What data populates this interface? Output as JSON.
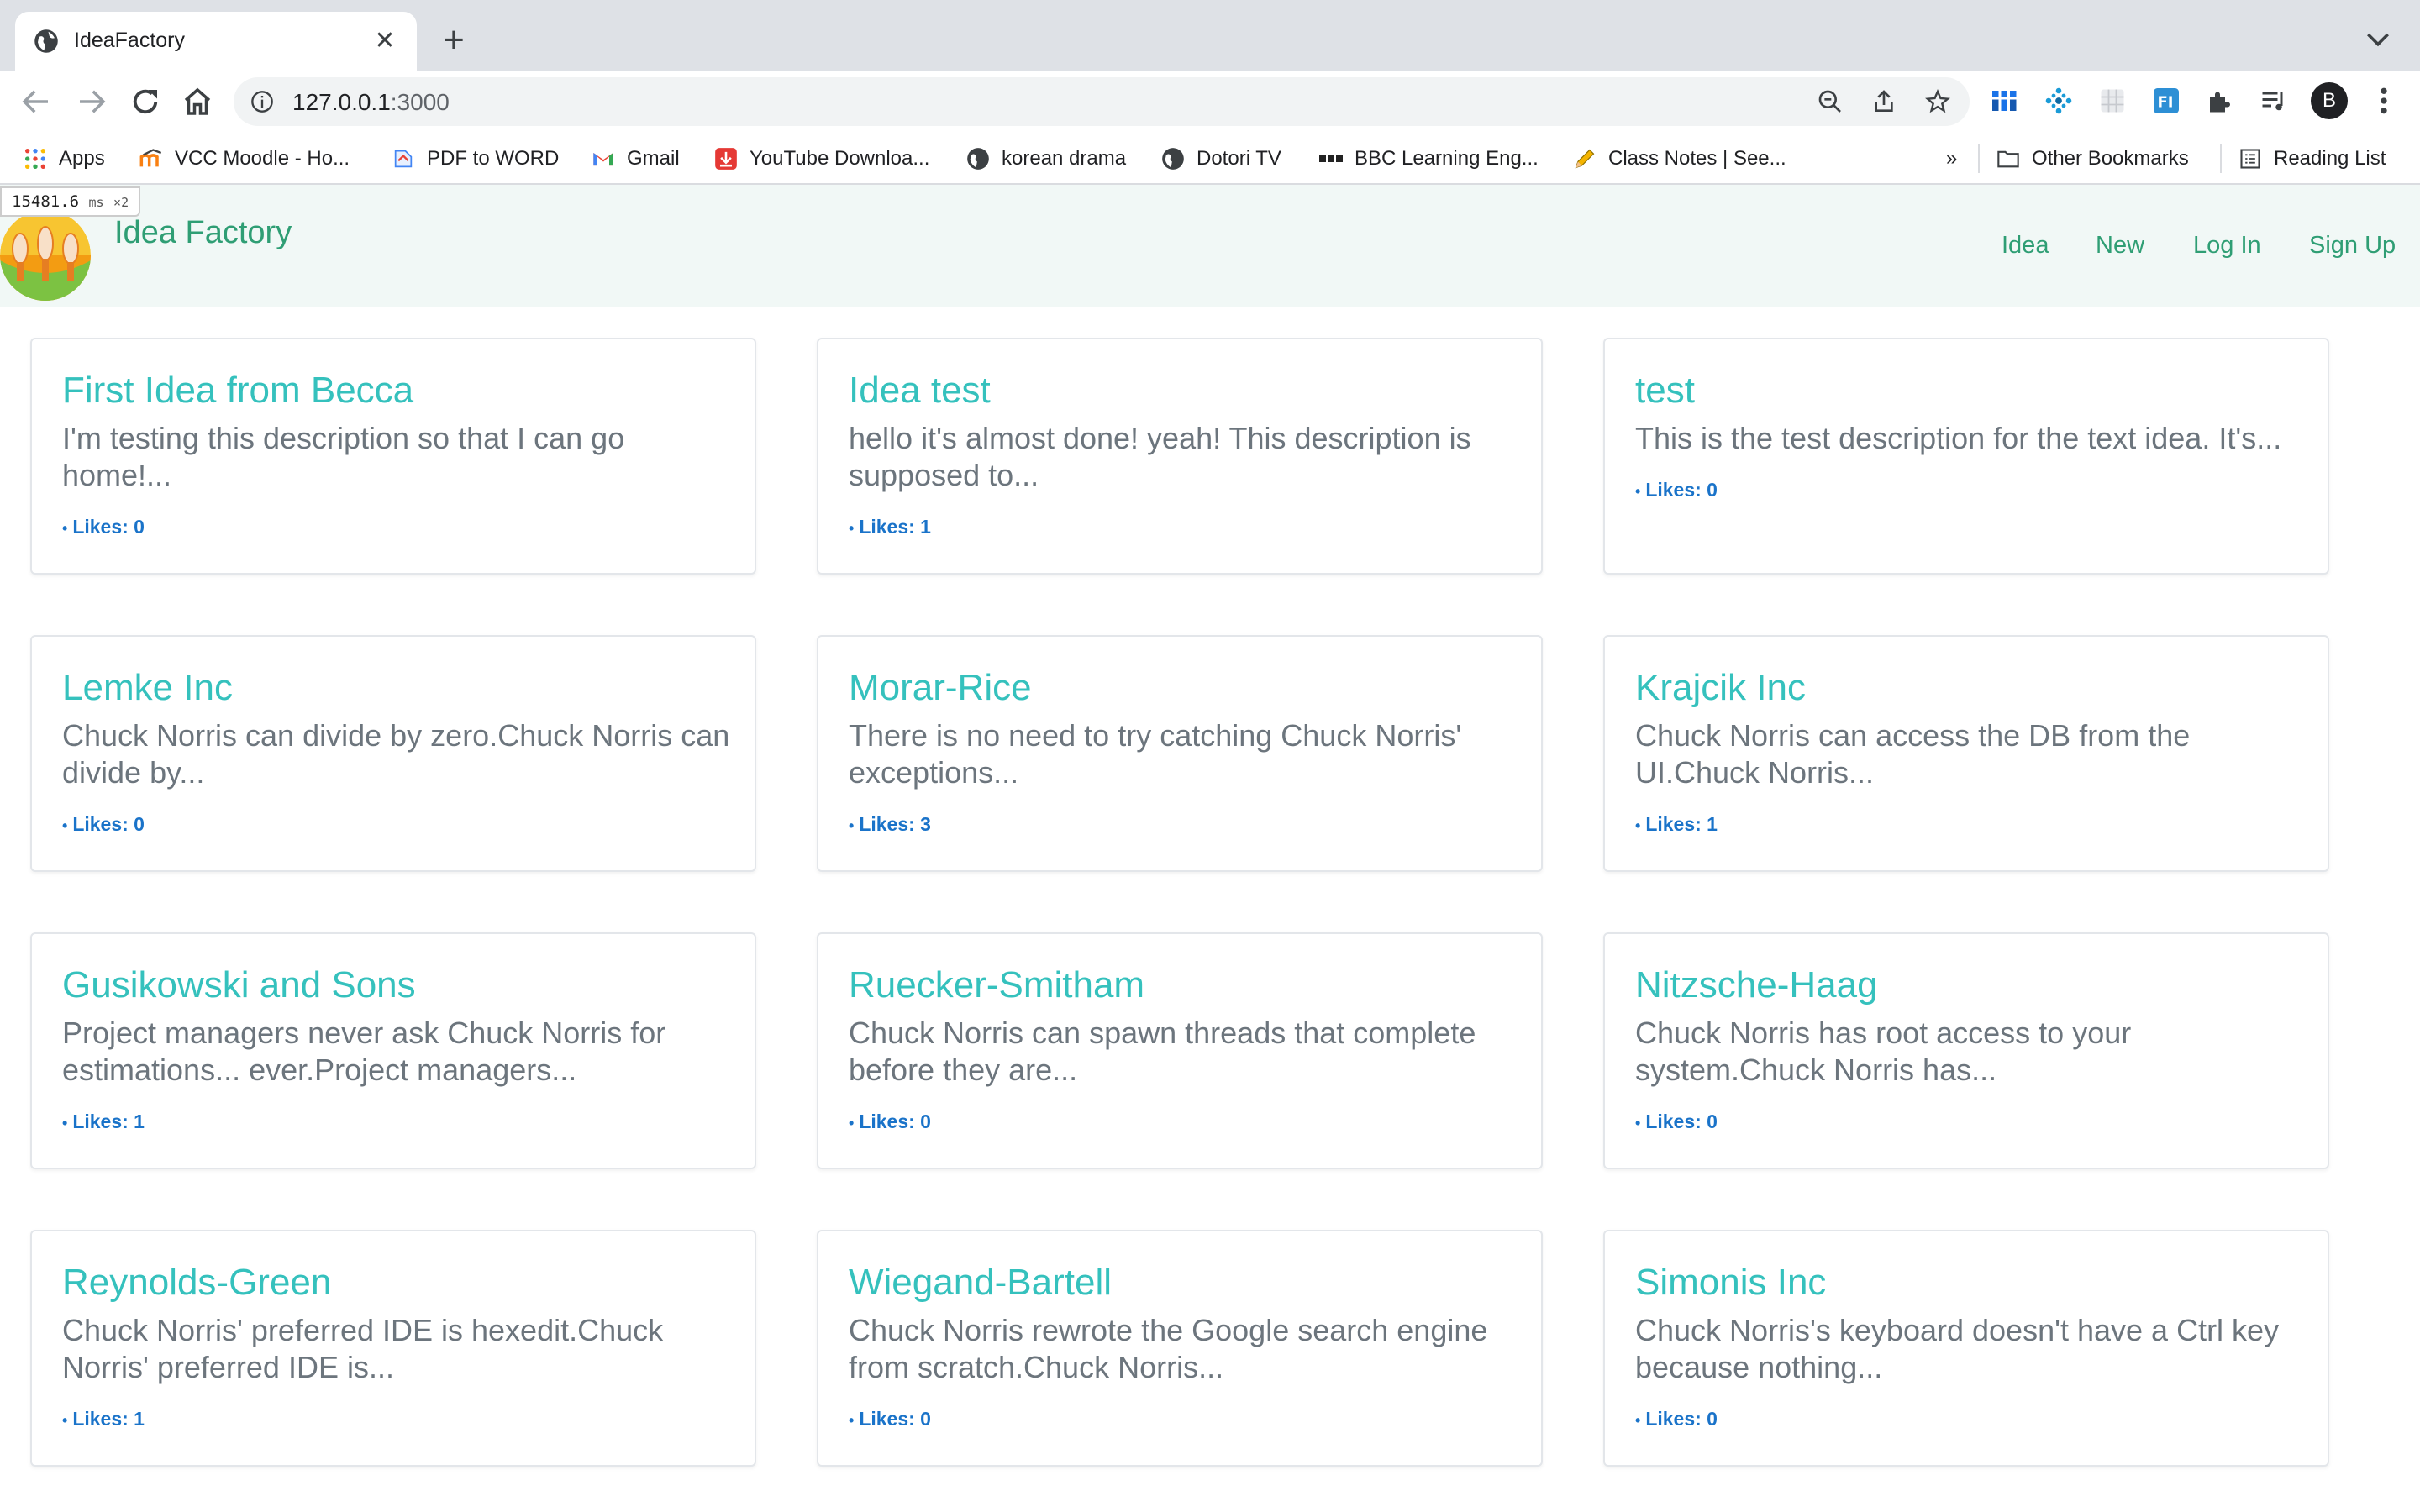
{
  "browser": {
    "tab_title": "IdeaFactory",
    "url_host": "127.0.0.1",
    "url_port": ":3000",
    "profile_initial": "B",
    "bookmarks": [
      {
        "label": "Apps",
        "icon": "apps-grid-icon"
      },
      {
        "label": "VCC Moodle - Ho...",
        "icon": "moodle-icon"
      },
      {
        "label": "PDF to WORD",
        "icon": "pdf-converter-icon"
      },
      {
        "label": "Gmail",
        "icon": "gmail-icon"
      },
      {
        "label": "YouTube Downloa...",
        "icon": "download-icon"
      },
      {
        "label": "korean drama",
        "icon": "globe-icon"
      },
      {
        "label": "Dotori TV",
        "icon": "globe-icon"
      },
      {
        "label": "BBC Learning Eng...",
        "icon": "bbc-icon"
      },
      {
        "label": "Class Notes | See...",
        "icon": "pencil-icon"
      }
    ],
    "overflow_label": "»",
    "other_bookmarks": "Other Bookmarks",
    "reading_list": "Reading List"
  },
  "perf": {
    "ms": "15481.6",
    "unit": "ms",
    "multiplier": "×2"
  },
  "navbar": {
    "brand": "Idea Factory",
    "links": [
      "Idea",
      "New",
      "Log In",
      "Sign Up"
    ]
  },
  "ideas": [
    {
      "title": "First Idea from Becca",
      "description": "I'm testing this description so that I can go home!...",
      "likes": "Likes: 0"
    },
    {
      "title": "Idea test",
      "description": "hello it's almost done! yeah! This description is supposed to...",
      "likes": "Likes: 1"
    },
    {
      "title": "test",
      "description": "This is the test description for the text idea. It's...",
      "likes": "Likes: 0"
    },
    {
      "title": "Lemke Inc",
      "description": "Chuck Norris can divide by zero.Chuck Norris can divide by...",
      "likes": "Likes: 0"
    },
    {
      "title": "Morar-Rice",
      "description": "There is no need to try catching Chuck Norris' exceptions...",
      "likes": "Likes: 3"
    },
    {
      "title": "Krajcik Inc",
      "description": "Chuck Norris can access the DB from the UI.Chuck Norris...",
      "likes": "Likes: 1"
    },
    {
      "title": "Gusikowski and Sons",
      "description": "Project managers never ask Chuck Norris for estimations... ever.Project managers...",
      "likes": "Likes: 1"
    },
    {
      "title": "Ruecker-Smitham",
      "description": "Chuck Norris can spawn threads that complete before they are...",
      "likes": "Likes: 0"
    },
    {
      "title": "Nitzsche-Haag",
      "description": "Chuck Norris has root access to your system.Chuck Norris has...",
      "likes": "Likes: 0"
    },
    {
      "title": "Reynolds-Green",
      "description": "Chuck Norris' preferred IDE is hexedit.Chuck Norris' preferred IDE is...",
      "likes": "Likes: 1"
    },
    {
      "title": "Wiegand-Bartell",
      "description": "Chuck Norris rewrote the Google search engine from scratch.Chuck Norris...",
      "likes": "Likes: 0"
    },
    {
      "title": "Simonis Inc",
      "description": "Chuck Norris's keyboard doesn't have a Ctrl key because nothing...",
      "likes": "Likes: 0"
    }
  ],
  "colors": {
    "brand_green": "#2f9e74",
    "card_title": "#35c1bd",
    "likes_blue": "#1a73c9",
    "navbar_bg": "#f1f8f6"
  }
}
